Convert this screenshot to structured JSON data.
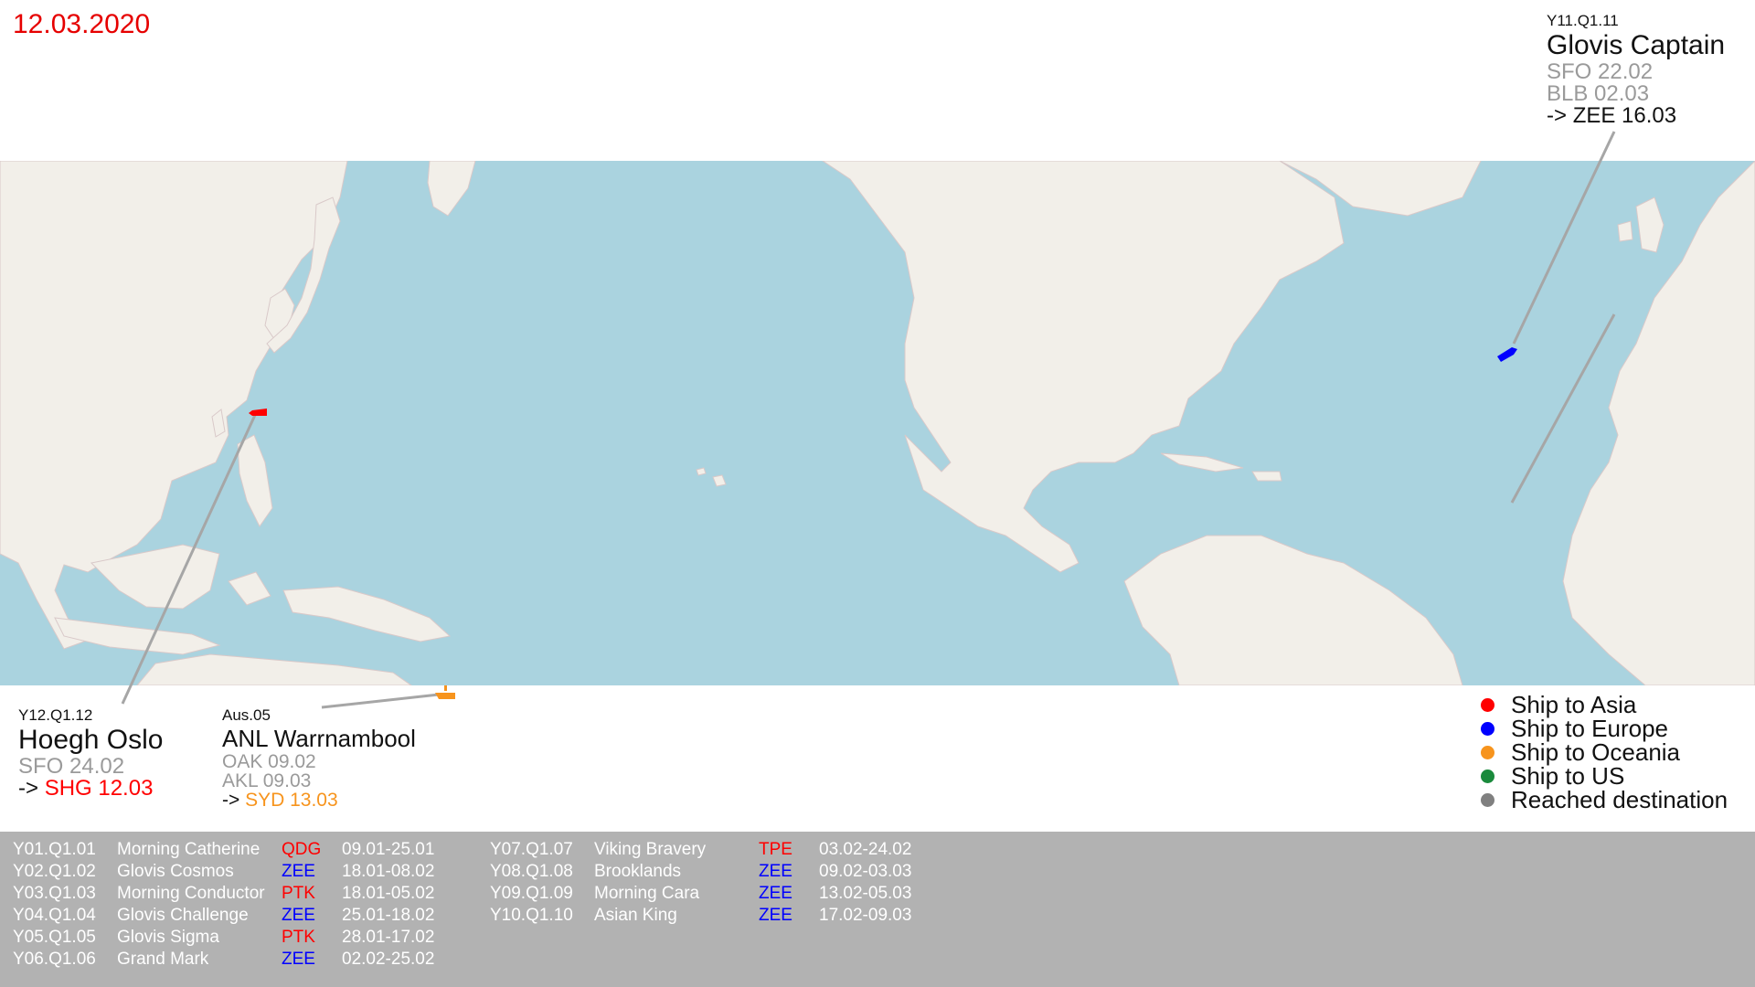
{
  "date": "12.03.2020",
  "colors": {
    "asia": "#ff0000",
    "europe": "#0000ff",
    "oceania": "#f7941d",
    "us": "#1a8a3c",
    "reached": "#808080",
    "ocean": "#aad3df",
    "land": "#f2efe9"
  },
  "cards": {
    "glovis_captain": {
      "code": "Y11.Q1.11",
      "name": "Glovis Captain",
      "stops": [
        "SFO 22.02",
        "BLB 02.03"
      ],
      "dest_prefix": "-> ",
      "dest": "ZEE 16.03",
      "dest_color": "#111111"
    },
    "hoegh_oslo": {
      "code": "Y12.Q1.12",
      "name": "Hoegh Oslo",
      "stops": [
        "SFO 24.02"
      ],
      "dest_prefix": "-> ",
      "dest": "SHG 12.03",
      "dest_color": "#ff0000"
    },
    "anl_warrnambool": {
      "code": "Aus.05",
      "name": "ANL Warrnambool",
      "stops": [
        "OAK 09.02",
        "AKL 09.03"
      ],
      "dest_prefix": "-> ",
      "dest": "SYD 13.03",
      "dest_color": "#f7941d"
    }
  },
  "legend": [
    {
      "label": "Ship to Asia",
      "color": "#ff0000"
    },
    {
      "label": "Ship to Europe",
      "color": "#0000ff"
    },
    {
      "label": "Ship to Oceania",
      "color": "#f7941d"
    },
    {
      "label": "Ship to US",
      "color": "#1a8a3c"
    },
    {
      "label": "Reached destination",
      "color": "#808080"
    }
  ],
  "table": {
    "left": [
      {
        "code": "Y01.Q1.01",
        "ship": "Morning Catherine",
        "port": "QDG",
        "port_color": "#ff0000",
        "dates": "09.01-25.01"
      },
      {
        "code": "Y02.Q1.02",
        "ship": "Glovis Cosmos",
        "port": "ZEE",
        "port_color": "#0000ff",
        "dates": "18.01-08.02"
      },
      {
        "code": "Y03.Q1.03",
        "ship": "Morning Conductor",
        "port": "PTK",
        "port_color": "#ff0000",
        "dates": "18.01-05.02"
      },
      {
        "code": "Y04.Q1.04",
        "ship": "Glovis Challenge",
        "port": "ZEE",
        "port_color": "#0000ff",
        "dates": "25.01-18.02"
      },
      {
        "code": "Y05.Q1.05",
        "ship": "Glovis Sigma",
        "port": "PTK",
        "port_color": "#ff0000",
        "dates": "28.01-17.02"
      },
      {
        "code": "Y06.Q1.06",
        "ship": "Grand Mark",
        "port": "ZEE",
        "port_color": "#0000ff",
        "dates": "02.02-25.02"
      }
    ],
    "right": [
      {
        "code": "Y07.Q1.07",
        "ship": "Viking Bravery",
        "port": "TPE",
        "port_color": "#ff0000",
        "dates": "03.02-24.02"
      },
      {
        "code": "Y08.Q1.08",
        "ship": "Brooklands",
        "port": "ZEE",
        "port_color": "#0000ff",
        "dates": "09.02-03.03"
      },
      {
        "code": "Y09.Q1.09",
        "ship": "Morning Cara",
        "port": "ZEE",
        "port_color": "#0000ff",
        "dates": "13.02-05.03"
      },
      {
        "code": "Y10.Q1.10",
        "ship": "Asian King",
        "port": "ZEE",
        "port_color": "#0000ff",
        "dates": "17.02-09.03"
      }
    ]
  }
}
